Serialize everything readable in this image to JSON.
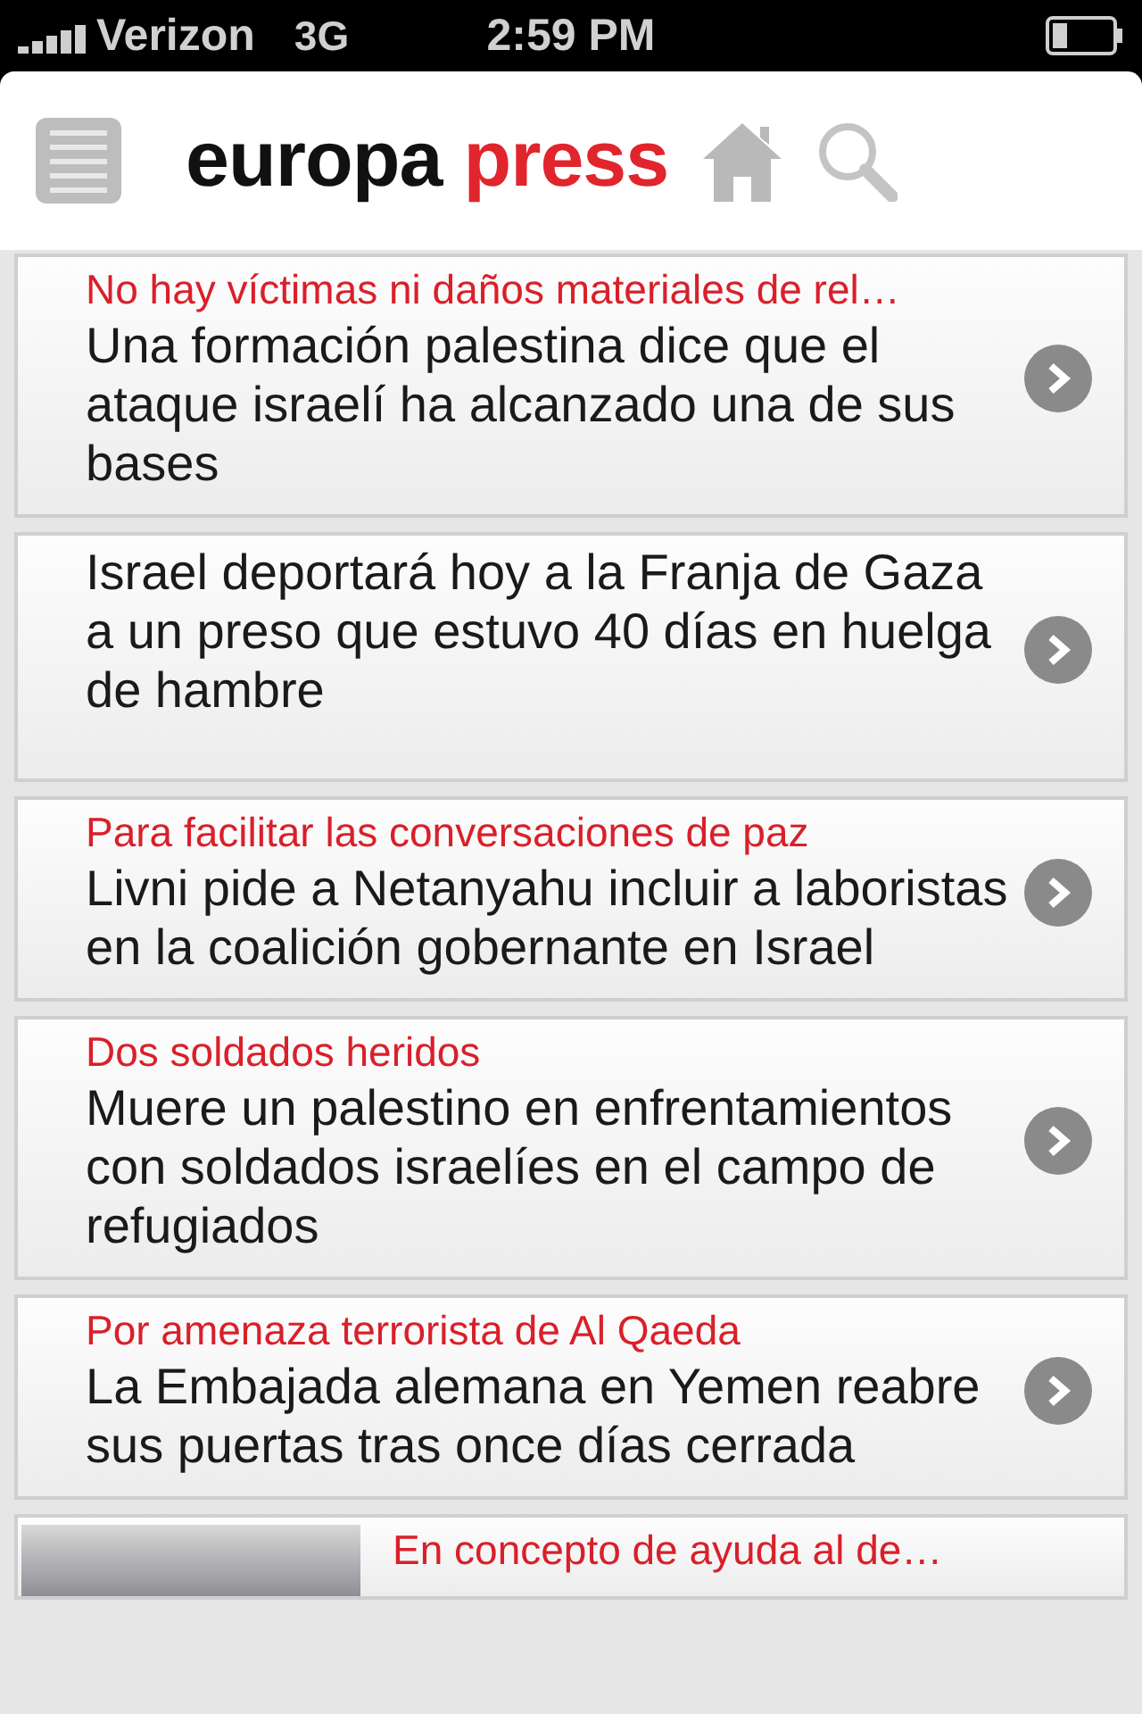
{
  "status_bar": {
    "carrier": "Verizon",
    "network": "3G",
    "time": "2:59 PM"
  },
  "header": {
    "logo": {
      "first": "europa",
      "second": "press"
    }
  },
  "articles": [
    {
      "kind": "text",
      "kicker": "No hay víctimas ni daños materiales de rel…",
      "headline": "Una formación palestina dice que el ataque israelí ha alcanzado una de sus bases"
    },
    {
      "kind": "text",
      "headline": "Israel deportará hoy a la Franja de Gaza a un preso que estuvo 40 días en huelga de hambre"
    },
    {
      "kind": "text",
      "kicker": "Para facilitar las conversaciones de paz",
      "headline": "Livni pide a Netanyahu incluir a laboristas en la coalición gobernante en Israel"
    },
    {
      "kind": "text",
      "kicker": "Dos soldados heridos",
      "headline": "Muere un palestino en enfrentamientos con soldados israelíes en el campo de refugiados"
    },
    {
      "kind": "text",
      "kicker": "Por amenaza terrorista de Al Qaeda",
      "headline": "La Embajada alemana en Yemen reabre sus puertas tras once días cerrada"
    },
    {
      "kind": "photo",
      "kicker": "En concepto de ayuda al de…"
    }
  ]
}
